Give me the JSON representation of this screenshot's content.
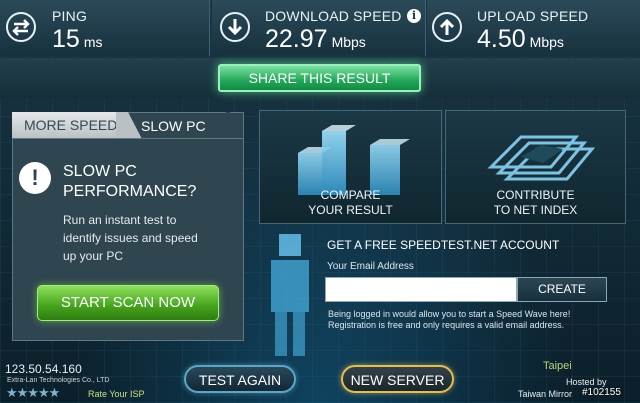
{
  "stats": {
    "ping": {
      "label": "PING",
      "value": "15",
      "unit": "ms",
      "icon": "exchange-arrows-icon"
    },
    "download": {
      "label": "DOWNLOAD SPEED",
      "value": "22.97",
      "unit": "Mbps",
      "icon": "download-arrow-icon",
      "info": "i"
    },
    "upload": {
      "label": "UPLOAD SPEED",
      "value": "4.50",
      "unit": "Mbps",
      "icon": "upload-arrow-icon"
    }
  },
  "share": {
    "label": "SHARE THIS RESULT"
  },
  "panel": {
    "tabs": [
      {
        "label": "MORE SPEED",
        "active": false
      },
      {
        "label": "SLOW PC",
        "active": true
      }
    ],
    "alert_symbol": "!",
    "title_line1": "SLOW PC",
    "title_line2": "PERFORMANCE?",
    "desc_line1": "Run an instant test to",
    "desc_line2": "identify issues and speed",
    "desc_line3": "up your PC",
    "button": "START SCAN NOW"
  },
  "compare": {
    "line1": "COMPARE",
    "line2": "YOUR RESULT"
  },
  "contribute": {
    "line1": "CONTRIBUTE",
    "line2": "TO NET INDEX"
  },
  "account": {
    "title": "GET A FREE SPEEDTEST.NET ACCOUNT",
    "email_label": "Your Email Address",
    "email_value": "",
    "create": "CREATE",
    "note_line1": "Being logged in would allow you to start a Speed Wave here!",
    "note_line2": "Registration is free and only requires a valid email address."
  },
  "footer": {
    "ip": "123.50.54.160",
    "isp": "Extra-Lan Technologies Co., LTD",
    "stars": "★★★★★",
    "rate": "Rate Your ISP",
    "test_again": "TEST AGAIN",
    "new_server": "NEW SERVER",
    "location": "Taipei",
    "hosted_by": "Hosted by",
    "host": "Taiwan Mirror",
    "watermark": "#102155"
  },
  "colors": {
    "accent_green": "#23a85a",
    "scan_green": "#45a21d",
    "server_gold": "#e2bf52",
    "test_blue": "#5ea6c6",
    "panel_bg": "#2f4550"
  }
}
